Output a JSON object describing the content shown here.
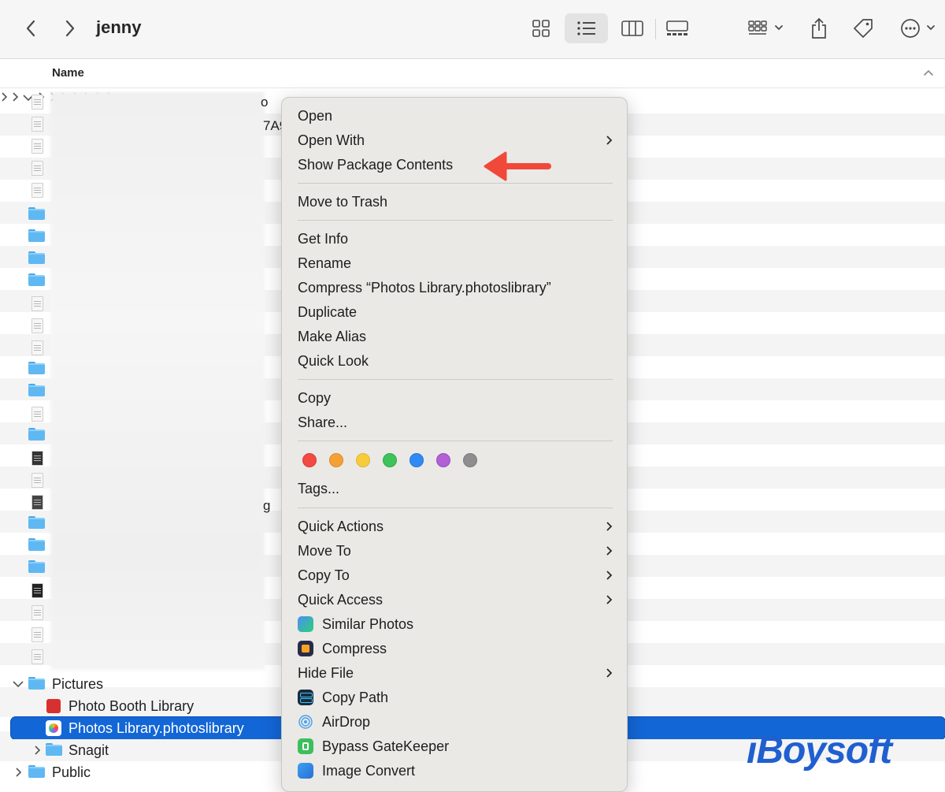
{
  "window": {
    "title": "jenny"
  },
  "toolbar": {
    "icons": [
      "back-icon",
      "forward-icon",
      "icon-view-icon",
      "list-view-icon",
      "column-view-icon",
      "gallery-view-icon",
      "group-icon",
      "share-icon",
      "tag-icon",
      "more-icon"
    ]
  },
  "header": {
    "name_label": "Name"
  },
  "list": {
    "fragments": [
      "o",
      "7A9",
      "g"
    ],
    "visible_rows": [
      {
        "label": "Pictures",
        "kind": "folder",
        "expanded": true
      },
      {
        "label": "Photo Booth Library",
        "kind": "app-library"
      },
      {
        "label": "Photos Library.photoslibrary",
        "kind": "photos-library",
        "selected": true
      },
      {
        "label": "Snagit",
        "kind": "folder",
        "expanded": false
      },
      {
        "label": "Public",
        "kind": "folder",
        "expanded": false
      }
    ]
  },
  "context_menu": {
    "items": {
      "open": "Open",
      "open_with": "Open With",
      "show_package": "Show Package Contents",
      "move_trash": "Move to Trash",
      "get_info": "Get Info",
      "rename": "Rename",
      "compress": "Compress “Photos Library.photoslibrary”",
      "duplicate": "Duplicate",
      "make_alias": "Make Alias",
      "quick_look": "Quick Look",
      "copy": "Copy",
      "share": "Share...",
      "tags": "Tags...",
      "quick_actions": "Quick Actions",
      "move_to": "Move To",
      "copy_to": "Copy To",
      "quick_access": "Quick Access",
      "similar_photos": "Similar Photos",
      "compress_app": "Compress",
      "hide_file": "Hide File",
      "copy_path": "Copy Path",
      "airdrop": "AirDrop",
      "bypass": "Bypass GateKeeper",
      "image_convert": "Image Convert"
    },
    "tag_colors": [
      "#f24b43",
      "#f4a035",
      "#f7cc3c",
      "#3fc25b",
      "#2f8af5",
      "#b160d6",
      "#8e8e8e"
    ]
  },
  "watermark": {
    "text": "iBoysoft"
  }
}
